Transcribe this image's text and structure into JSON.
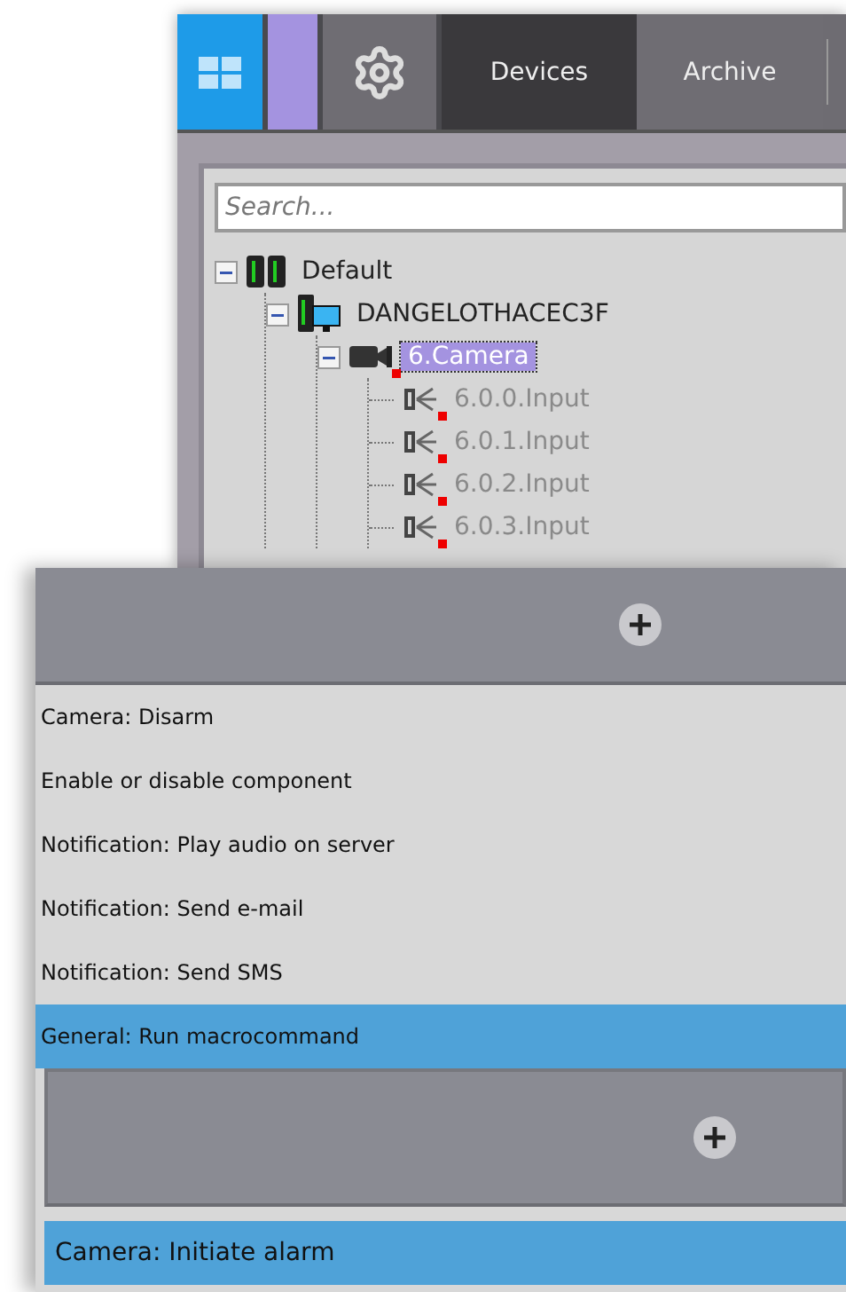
{
  "toolbar": {
    "tiles": [
      {
        "kind": "layouts"
      },
      {
        "kind": "accent"
      },
      {
        "kind": "settings"
      }
    ],
    "tabs": [
      {
        "label": "Devices",
        "selected": true
      },
      {
        "label": "Archive",
        "selected": false
      }
    ]
  },
  "search": {
    "placeholder": "Search..."
  },
  "tree": [
    {
      "label": "Default",
      "kind": "group",
      "selected": false,
      "expanded": true,
      "alert": false,
      "disabled": false,
      "children": [
        {
          "label": "DANGELOTHACEC3F",
          "kind": "server",
          "selected": false,
          "expanded": true,
          "alert": false,
          "disabled": false,
          "children": [
            {
              "label": "6.Camera",
              "kind": "camera",
              "selected": true,
              "expanded": true,
              "alert": true,
              "disabled": false,
              "children": [
                {
                  "label": "6.0.0.Input",
                  "kind": "input",
                  "selected": false,
                  "alert": true,
                  "disabled": true
                },
                {
                  "label": "6.0.1.Input",
                  "kind": "input",
                  "selected": false,
                  "alert": true,
                  "disabled": true
                },
                {
                  "label": "6.0.2.Input",
                  "kind": "input",
                  "selected": false,
                  "alert": true,
                  "disabled": true
                },
                {
                  "label": "6.0.3.Input",
                  "kind": "input",
                  "selected": false,
                  "alert": true,
                  "disabled": true
                }
              ]
            }
          ]
        }
      ]
    }
  ],
  "actions": [
    {
      "label": "Camera: Disarm",
      "selected": false
    },
    {
      "label": "Enable or disable component",
      "selected": false
    },
    {
      "label": "Notification: Play audio on server",
      "selected": false
    },
    {
      "label": "Notification: Send e-mail",
      "selected": false
    },
    {
      "label": "Notification: Send SMS",
      "selected": false
    },
    {
      "label": "General: Run macrocommand",
      "selected": true
    }
  ],
  "sub_actions": [
    {
      "label": "Camera: Initiate alarm",
      "selected": true
    }
  ]
}
